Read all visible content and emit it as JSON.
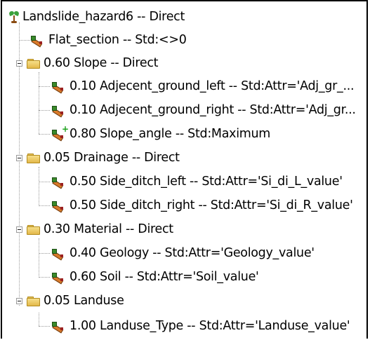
{
  "tree": {
    "root": {
      "label": "Landslide_hazard6 -- Direct"
    },
    "flat_section": {
      "label": "Flat_section -- Std:<>0"
    },
    "slope": {
      "label": "0.60 Slope -- Direct",
      "children": [
        {
          "label": "0.10 Adjecent_ground_left -- Std:Attr='Adj_gr_..."
        },
        {
          "label": "0.10 Adjecent_ground_right -- Std:Attr='Adj_gr..."
        },
        {
          "label": "0.80 Slope_angle -- Std:Maximum"
        }
      ]
    },
    "drainage": {
      "label": "0.05 Drainage -- Direct",
      "children": [
        {
          "label": "0.50 Side_ditch_left -- Std:Attr='Si_di_L_value'"
        },
        {
          "label": "0.50 Side_ditch_right -- Std:Attr='Si_di_R_value'"
        }
      ]
    },
    "material": {
      "label": "0.30 Material -- Direct",
      "children": [
        {
          "label": "0.40 Geology -- Std:Attr='Geology_value'"
        },
        {
          "label": "0.60 Soil -- Std:Attr='Soil_value'"
        }
      ]
    },
    "landuse": {
      "label": "0.05 Landuse",
      "children": [
        {
          "label": "1.00 Landuse_Type -- Std:Attr='Landuse_value'"
        }
      ]
    }
  },
  "icons": {
    "root": "tree-icon",
    "group": "folder-icon",
    "criterion": "criterion-icon",
    "added_criterion": "criterion-plus-icon",
    "expander": "collapse-icon"
  },
  "colors": {
    "border": "#000000",
    "tree_lines": "#9a9a9a",
    "folder": "#e3b84a"
  }
}
